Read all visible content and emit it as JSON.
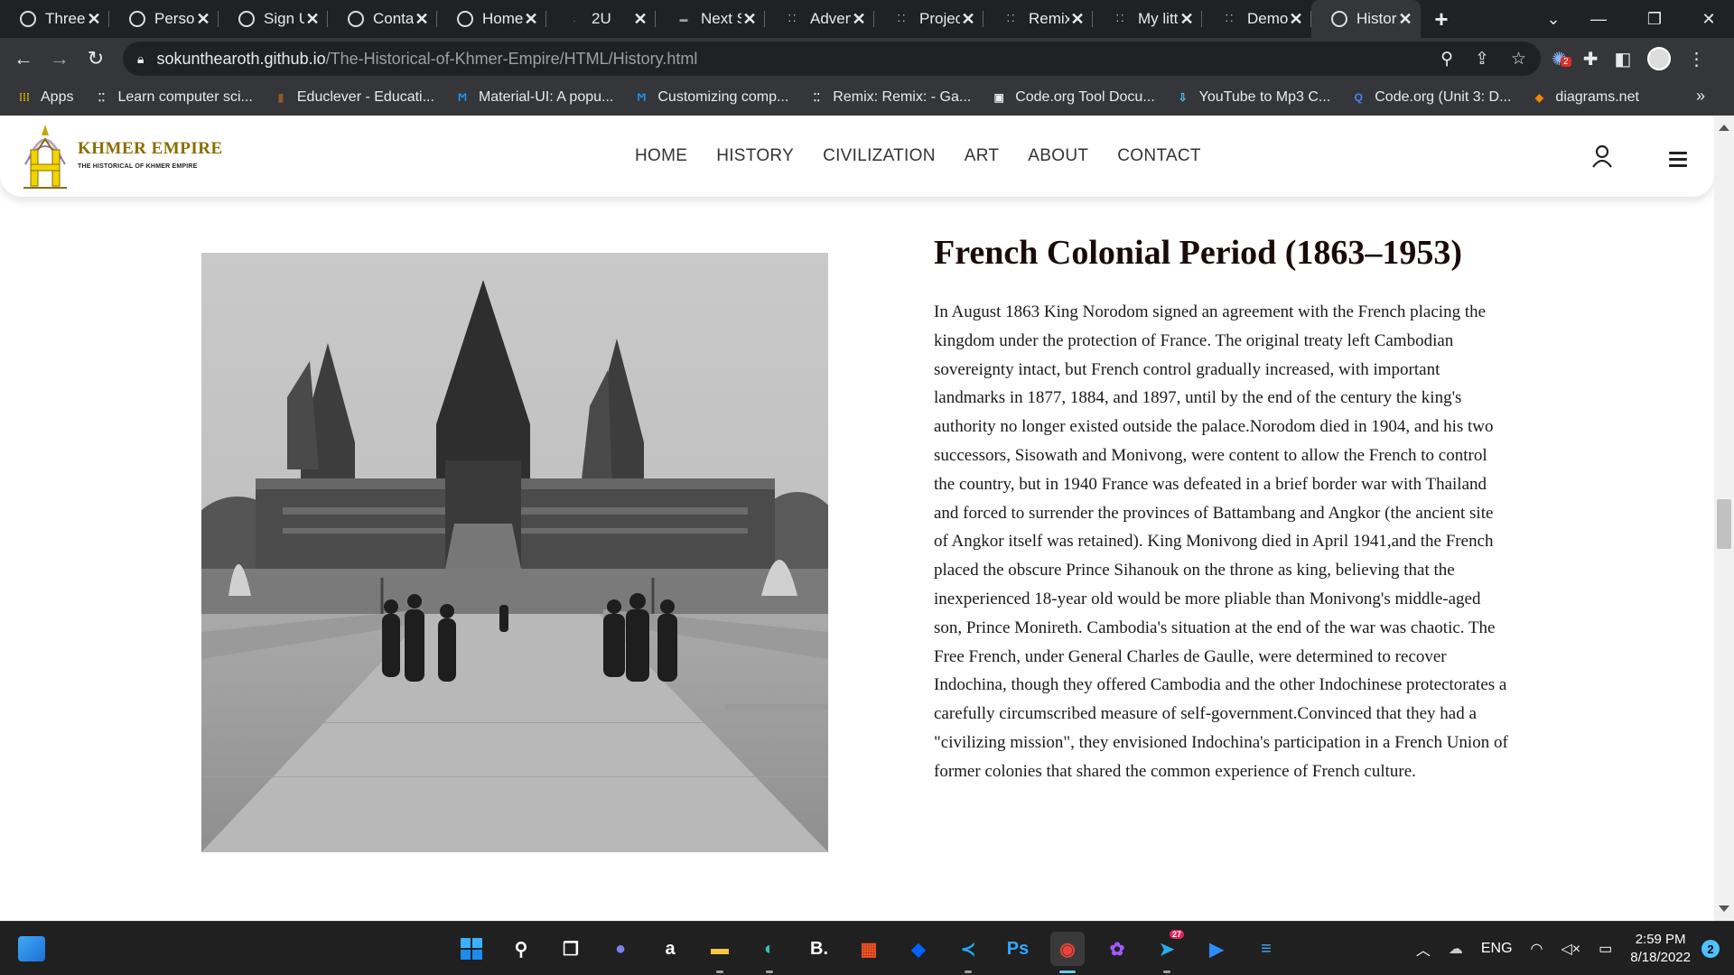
{
  "browser": {
    "tabs": [
      {
        "title": "Three",
        "favicon": "globe-icon"
      },
      {
        "title": "Persor",
        "favicon": "globe-icon"
      },
      {
        "title": "Sign U",
        "favicon": "globe-icon"
      },
      {
        "title": "Conta",
        "favicon": "globe-icon"
      },
      {
        "title": "Home",
        "favicon": "globe-icon"
      },
      {
        "title": "2U",
        "favicon": "dot-icon"
      },
      {
        "title": "Next S",
        "favicon": "news-icon"
      },
      {
        "title": "Adven",
        "favicon": "dots-icon"
      },
      {
        "title": "Projec",
        "favicon": "dots-icon"
      },
      {
        "title": "Remix",
        "favicon": "dots-icon"
      },
      {
        "title": "My litt",
        "favicon": "dots-icon"
      },
      {
        "title": "Demo",
        "favicon": "dots-icon"
      },
      {
        "title": "Histor",
        "favicon": "globe-icon",
        "active": true
      }
    ],
    "new_tab_label": "+",
    "url_host": "sokunthearoth.github.io",
    "url_path": "/The-Historical-of-Khmer-Empire/HTML/History.html",
    "extension_badge": "2"
  },
  "bookmarks": [
    {
      "label": "Apps",
      "icon": "apps-grid-icon",
      "color": "#f4b400"
    },
    {
      "label": "Learn computer sci...",
      "icon": "code-org-icon",
      "color": "#e8eaed"
    },
    {
      "label": "Educlever - Educati...",
      "icon": "book-icon",
      "color": "#8d5a2b"
    },
    {
      "label": "Material-UI: A popu...",
      "icon": "mui-icon",
      "color": "#2196f3"
    },
    {
      "label": "Customizing comp...",
      "icon": "mui-icon",
      "color": "#2196f3"
    },
    {
      "label": "Remix: Remix: - Ga...",
      "icon": "code-org-icon",
      "color": "#e8eaed"
    },
    {
      "label": "Code.org Tool Docu...",
      "icon": "code-org-box-icon",
      "color": "#e8eaed"
    },
    {
      "label": "YouTube to Mp3 C...",
      "icon": "download-icon",
      "color": "#4fc3f7"
    },
    {
      "label": "Code.org (Unit 3: D...",
      "icon": "search-q-icon",
      "color": "#4285f4"
    },
    {
      "label": "diagrams.net",
      "icon": "diagrams-icon",
      "color": "#f08705"
    }
  ],
  "bookmarks_overflow": "»",
  "site": {
    "brand_name": "KHMER EMPIRE",
    "brand_tagline": "THE HISTORICAL OF KHMER EMPIRE",
    "menu": [
      "HOME",
      "HISTORY",
      "CIVILIZATION",
      "ART",
      "ABOUT",
      "CONTACT"
    ]
  },
  "article": {
    "title": "French Colonial Period (1863–1953)",
    "body": "In August 1863 King Norodom signed an agreement with the French placing the kingdom under the protection of France. The original treaty left Cambodian sovereignty intact, but French control gradually increased, with important landmarks in 1877, 1884, and 1897, until by the end of the century the king's authority no longer existed outside the palace.Norodom died in 1904, and his two successors, Sisowath and Monivong, were content to allow the French to control the country, but in 1940 France was defeated in a brief border war with Thailand and forced to surrender the provinces of Battambang and Angkor (the ancient site of Angkor itself was retained). King Monivong died in April 1941,and the French placed the obscure Prince Sihanouk on the throne as king, believing that the inexperienced 18-year old would be more pliable than Monivong's middle-aged son, Prince Monireth. Cambodia's situation at the end of the war was chaotic. The Free French, under General Charles de Gaulle, were determined to recover Indochina, though they offered Cambodia and the other Indochinese protectorates a carefully circumscribed measure of self-government.Convinced that they had a \"civilizing mission\", they envisioned Indochina's participation in a French Union of former colonies that shared the common experience of French culture."
  },
  "taskbar": {
    "apps": [
      {
        "name": "start-icon",
        "glyph": "",
        "color": "#2b8ef7"
      },
      {
        "name": "search-icon",
        "glyph": "⚲",
        "color": "#ffffff"
      },
      {
        "name": "task-view-icon",
        "glyph": "❐",
        "color": "#ffffff"
      },
      {
        "name": "chat-icon",
        "glyph": "●",
        "color": "#7b83eb"
      },
      {
        "name": "amazon-icon",
        "glyph": "a",
        "color": "#ffffff"
      },
      {
        "name": "file-explorer-icon",
        "glyph": "▬",
        "color": "#f4c542"
      },
      {
        "name": "edge-icon",
        "glyph": "◐",
        "color": "#2ec4b6"
      },
      {
        "name": "booking-icon",
        "glyph": "B.",
        "color": "#ffffff"
      },
      {
        "name": "store-icon",
        "glyph": "▦",
        "color": "#f25022"
      },
      {
        "name": "dropbox-icon",
        "glyph": "◆",
        "color": "#0061ff"
      },
      {
        "name": "vscode-icon",
        "glyph": "≺",
        "color": "#23a9f2"
      },
      {
        "name": "photoshop-icon",
        "glyph": "Ps",
        "color": "#31a8ff"
      },
      {
        "name": "chrome-icon",
        "glyph": "◉",
        "color": "#ea4335",
        "active": true
      },
      {
        "name": "figma-icon",
        "glyph": "✿",
        "color": "#a259ff"
      },
      {
        "name": "telegram-icon",
        "glyph": "➤",
        "color": "#2aabee"
      },
      {
        "name": "zoom-icon",
        "glyph": "▶",
        "color": "#2d8cff"
      },
      {
        "name": "notepad-icon",
        "glyph": "≡",
        "color": "#3fa9f5"
      }
    ],
    "telegram_badge": "27",
    "language": "ENG",
    "time": "2:59 PM",
    "date": "8/18/2022",
    "notifications": "2"
  }
}
